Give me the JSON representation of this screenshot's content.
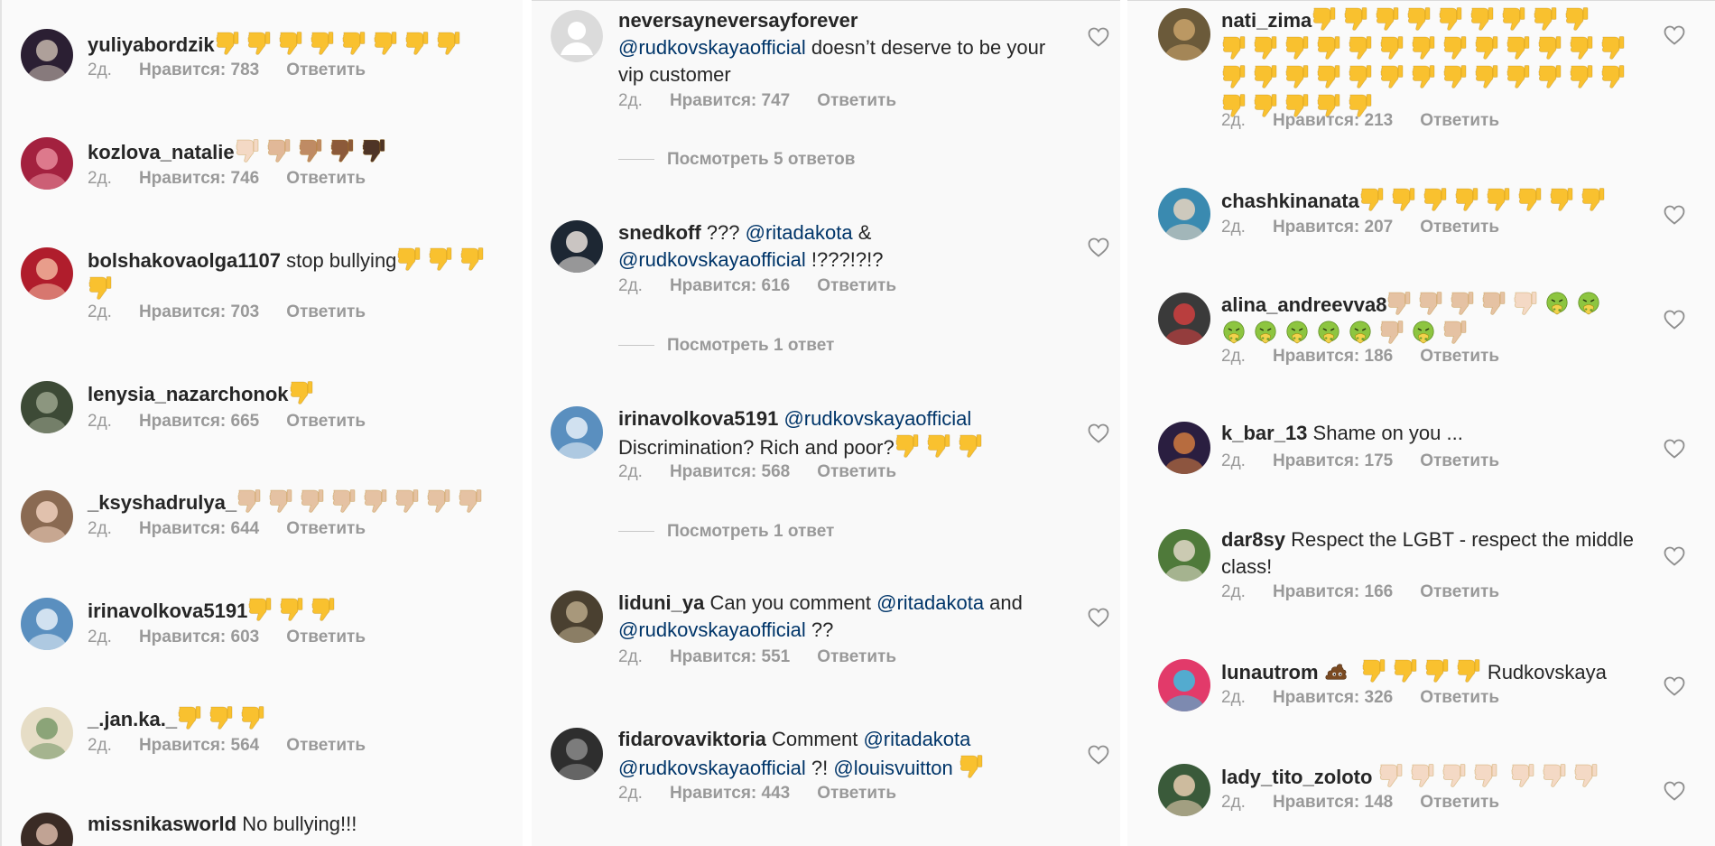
{
  "panels": [
    {
      "comments": [
        {
          "username": "yuliyabordzik",
          "body": [
            {
              "t": "emoji",
              "k": "td",
              "n": 8,
              "c": "#f9c12f"
            }
          ],
          "age": "2д.",
          "likes": "Нравится: 783",
          "reply": "Ответить",
          "avatar": [
            "#2b1f33",
            "#c5b7ad"
          ]
        },
        {
          "username": "kozlova_natalie",
          "body": [
            {
              "t": "emoji",
              "k": "td",
              "c": "#f4d9c5"
            },
            {
              "t": "emoji",
              "k": "td",
              "c": "#e1b898"
            },
            {
              "t": "emoji",
              "k": "td",
              "c": "#bf8b64"
            },
            {
              "t": "emoji",
              "k": "td",
              "c": "#8c5a3a"
            },
            {
              "t": "emoji",
              "k": "td",
              "c": "#4e3426"
            }
          ],
          "age": "2д.",
          "likes": "Нравится: 746",
          "reply": "Ответить",
          "avatar": [
            "#a3213f",
            "#e7889a"
          ]
        },
        {
          "username": "bolshakovaolga1107",
          "body": [
            {
              "t": "text",
              "v": " stop bullying"
            },
            {
              "t": "emoji",
              "k": "td",
              "n": 4,
              "c": "#f9c12f"
            }
          ],
          "age": "2д.",
          "likes": "Нравится: 703",
          "reply": "Ответить",
          "avatar": [
            "#b01d2c",
            "#f2b49c"
          ]
        },
        {
          "username": "lenysia_nazarchonok",
          "body": [
            {
              "t": "emoji",
              "k": "td",
              "n": 1,
              "c": "#f9c12f"
            }
          ],
          "age": "2д.",
          "likes": "Нравится: 665",
          "reply": "Ответить",
          "avatar": [
            "#3d4a36",
            "#9aa38c"
          ]
        },
        {
          "username": "_ksyshadrulya_",
          "body": [
            {
              "t": "emoji",
              "k": "td",
              "n": 8,
              "c": "#e5c2a3"
            }
          ],
          "age": "2д.",
          "likes": "Нравится: 644",
          "reply": "Ответить",
          "avatar": [
            "#8a6a52",
            "#f0d0bd"
          ]
        },
        {
          "username": "irinavolkova5191",
          "body": [
            {
              "t": "emoji",
              "k": "td",
              "n": 3,
              "c": "#f9c12f"
            }
          ],
          "age": "2д.",
          "likes": "Нравится: 603",
          "reply": "Ответить",
          "avatar": [
            "#5a8fbf",
            "#e6f0f8"
          ]
        },
        {
          "username": "_.jan.ka._",
          "body": [
            {
              "t": "emoji",
              "k": "td",
              "n": 3,
              "c": "#f9c12f"
            }
          ],
          "age": "2д.",
          "likes": "Нравится: 564",
          "reply": "Ответить",
          "avatar": [
            "#e6ddc6",
            "#7a9a6a"
          ]
        },
        {
          "username": "missnikasworld",
          "body": [
            {
              "t": "text",
              "v": " No bullying!!!"
            }
          ],
          "age": "",
          "likes": "",
          "reply": "",
          "avatar": [
            "#3a2b25",
            "#d9b9a8"
          ]
        }
      ]
    },
    {
      "comments": [
        {
          "username": "neversayneversayforever",
          "body": [
            {
              "t": "break"
            },
            {
              "t": "mention",
              "v": "@rudkovskayaofficial"
            },
            {
              "t": "text",
              "v": " doesn’t deserve to be your vip customer"
            }
          ],
          "age": "2д.",
          "likes": "Нравится: 747",
          "reply": "Ответить",
          "avatar": [
            "#dbdbdb",
            "#ffffff"
          ],
          "placeholder": true,
          "view_replies": "Посмотреть 5 ответов"
        },
        {
          "username": "snedkoff",
          "body": [
            {
              "t": "text",
              "v": " ??? "
            },
            {
              "t": "mention",
              "v": "@ritadakota"
            },
            {
              "t": "text",
              "v": " & "
            },
            {
              "t": "mention",
              "v": "@rudkovskayaofficial"
            },
            {
              "t": "text",
              "v": " !???!?!?"
            }
          ],
          "age": "2д.",
          "likes": "Нравится: 616",
          "reply": "Ответить",
          "avatar": [
            "#1d2733",
            "#e9e2dc"
          ],
          "view_replies": "Посмотреть 1 ответ"
        },
        {
          "username": "irinavolkova5191",
          "body": [
            {
              "t": "text",
              "v": " "
            },
            {
              "t": "mention",
              "v": "@rudkovskayaofficial"
            },
            {
              "t": "text",
              "v": " Discrimination? Rich and poor?"
            },
            {
              "t": "emoji",
              "k": "td",
              "n": 3,
              "c": "#f9c12f"
            }
          ],
          "age": "2д.",
          "likes": "Нравится: 568",
          "reply": "Ответить",
          "avatar": [
            "#5a8fbf",
            "#e6f0f8"
          ],
          "view_replies": "Посмотреть 1 ответ"
        },
        {
          "username": "liduni_ya",
          "body": [
            {
              "t": "text",
              "v": " Can you comment "
            },
            {
              "t": "mention",
              "v": "@ritadakota"
            },
            {
              "t": "text",
              "v": " and "
            },
            {
              "t": "mention",
              "v": "@rudkovskayaofficial"
            },
            {
              "t": "text",
              "v": " ??"
            }
          ],
          "age": "2д.",
          "likes": "Нравится: 551",
          "reply": "Ответить",
          "avatar": [
            "#4a4030",
            "#b8a888"
          ]
        },
        {
          "username": "fidarovaviktoria",
          "body": [
            {
              "t": "text",
              "v": " Comment "
            },
            {
              "t": "mention",
              "v": "@ritadakota"
            },
            {
              "t": "text",
              "v": " "
            },
            {
              "t": "mention",
              "v": "@rudkovskayaofficial"
            },
            {
              "t": "text",
              "v": " ?! "
            },
            {
              "t": "mention",
              "v": "@louisvuitton"
            },
            {
              "t": "text",
              "v": " "
            },
            {
              "t": "emoji",
              "k": "td",
              "n": 1,
              "c": "#f9c12f"
            }
          ],
          "age": "2д.",
          "likes": "Нравится: 443",
          "reply": "Ответить",
          "avatar": [
            "#2e2e2e",
            "#8a8a8a"
          ]
        }
      ]
    },
    {
      "comments": [
        {
          "username": "nati_zima",
          "body": [
            {
              "t": "emoji",
              "k": "td",
              "n": 9,
              "c": "#f9c12f"
            },
            {
              "t": "break"
            },
            {
              "t": "emoji",
              "k": "td",
              "n": 31,
              "c": "#f9c12f"
            }
          ],
          "age": "2д.",
          "likes": "Нравится: 213",
          "reply": "Ответить",
          "avatar": [
            "#6b5a3a",
            "#c9a36b"
          ]
        },
        {
          "username": "chashkinanata",
          "body": [
            {
              "t": "emoji",
              "k": "td",
              "n": 8,
              "c": "#f9c12f"
            }
          ],
          "age": "2д.",
          "likes": "Нравится: 207",
          "reply": "Ответить",
          "avatar": [
            "#3a8ab0",
            "#e8d4c0"
          ]
        },
        {
          "username": "alina_andreevva8",
          "body": [
            {
              "t": "emoji",
              "k": "td",
              "n": 4,
              "c": "#e5c2a3"
            },
            {
              "t": "emoji",
              "k": "td",
              "n": 1,
              "c": "#f4d9c5"
            },
            {
              "t": "emoji",
              "k": "sick",
              "n": 2
            },
            {
              "t": "break"
            },
            {
              "t": "emoji",
              "k": "sick",
              "n": 5
            },
            {
              "t": "emoji",
              "k": "td",
              "n": 1,
              "c": "#e5c2a3"
            },
            {
              "t": "emoji",
              "k": "sick",
              "n": 1
            },
            {
              "t": "emoji",
              "k": "td",
              "n": 1,
              "c": "#e5c2a3"
            }
          ],
          "age": "2д.",
          "likes": "Нравится: 186",
          "reply": "Ответить",
          "avatar": [
            "#3a3a3a",
            "#d04040"
          ]
        },
        {
          "username": "k_bar_13",
          "body": [
            {
              "t": "text",
              "v": " Shame on you ..."
            }
          ],
          "age": "2д.",
          "likes": "Нравится: 175",
          "reply": "Ответить",
          "avatar": [
            "#2a1e40",
            "#d07a40"
          ]
        },
        {
          "username": "dar8sy",
          "body": [
            {
              "t": "text",
              "v": " Respect the LGBT - respect the middle class!"
            }
          ],
          "age": "2д.",
          "likes": "Нравится: 166",
          "reply": "Ответить",
          "avatar": [
            "#4f7a3a",
            "#e0d8c8"
          ]
        },
        {
          "username": "lunautrom",
          "body": [
            {
              "t": "text",
              "v": " "
            },
            {
              "t": "emoji",
              "k": "poo"
            },
            {
              "t": "text",
              "v": " "
            },
            {
              "t": "emoji",
              "k": "td",
              "n": 4,
              "c": "#f9c12f"
            },
            {
              "t": "text",
              "v": "Rudkovskaya"
            }
          ],
          "age": "2д.",
          "likes": "Нравится: 326",
          "reply": "Ответить",
          "avatar": [
            "#e23a6a",
            "#3ac0e0"
          ]
        },
        {
          "username": "lady_tito_zoloto",
          "body": [
            {
              "t": "text",
              "v": " "
            },
            {
              "t": "emoji",
              "k": "td",
              "n": 4,
              "c": "#f4d9c5"
            },
            {
              "t": "text",
              "v": " "
            },
            {
              "t": "emoji",
              "k": "td",
              "n": 3,
              "c": "#f4d9c5"
            }
          ],
          "age": "2д.",
          "likes": "Нравится: 148",
          "reply": "Ответить",
          "avatar": [
            "#3a5a3a",
            "#e8cdb0"
          ]
        }
      ]
    }
  ],
  "icons": {
    "heart": "heart-outline-icon",
    "thumbs_down": "thumbs-down-emoji",
    "sick": "nauseated-face-emoji",
    "poo": "pile-of-poo-emoji"
  }
}
